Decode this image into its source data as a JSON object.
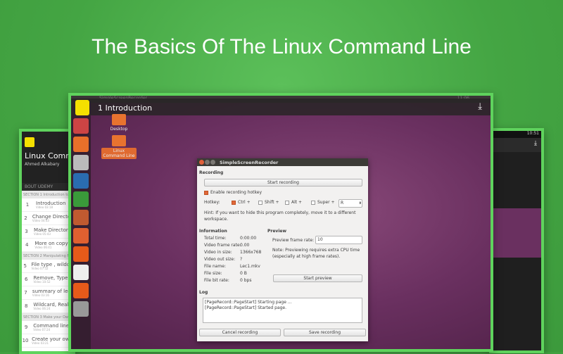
{
  "headline": "The Basics Of The Linux Command Line",
  "left_app": {
    "course_title": "Linux Comma",
    "author": "Ahmed Alkabary",
    "about": "BOUT UDEMY",
    "sections": [
      {
        "label": "SECTION 1  Introduction to th",
        "items": [
          {
            "n": "1",
            "t": "Introduction",
            "s": "Video 03:18"
          },
          {
            "n": "2",
            "t": "Change Director",
            "s": "Video 04:43"
          },
          {
            "n": "3",
            "t": "Make Directorie",
            "s": "Video 05:43"
          },
          {
            "n": "4",
            "t": "More on copyin",
            "s": "Video 06:41"
          }
        ]
      },
      {
        "label": "SECTION 2  Manipulating File",
        "items": [
          {
            "n": "5",
            "t": "File type , wildca",
            "s": "Video 07:52"
          },
          {
            "n": "6",
            "t": "Remove, Type o",
            "s": "Video 10:52"
          },
          {
            "n": "7",
            "t": "summary of lect",
            "s": "Video 03:16"
          },
          {
            "n": "8",
            "t": "Wildcard, Realiz",
            "s": "Video 06:24"
          }
        ]
      },
      {
        "label": "SECTION 3  Make your Own C",
        "items": [
          {
            "n": "9",
            "t": "Command line t",
            "s": "Video 07:24"
          },
          {
            "n": "10",
            "t": "Create your own",
            "s": "Video 03:21"
          }
        ]
      }
    ]
  },
  "right_app": {
    "clock": "10:51"
  },
  "main": {
    "lecture_title": "1  Introduction",
    "topbar_text": "SimpleScreenRecorder",
    "clock": "11:06",
    "desktop_icons": [
      "Desktop",
      "Linux Command Line"
    ],
    "launcher_icons": [
      "ubuntu-dash",
      "firefox",
      "files",
      "writer",
      "calc",
      "impress",
      "software-center",
      "udemy",
      "amazon",
      "udemy-alt",
      "stack"
    ],
    "dialog": {
      "title": "SimpleScreenRecorder",
      "recording_heading": "Recording",
      "start_recording": "Start recording",
      "enable_hotkey": "Enable recording hotkey",
      "hotkey_label": "Hotkey:",
      "ctrl": "Ctrl +",
      "shift": "Shift +",
      "alt": "Alt +",
      "super": "Super +",
      "key": "R",
      "hint": "Hint: If you want to hide this program completely, move it to a different workspace.",
      "information_heading": "Information",
      "info": [
        {
          "k": "Total time:",
          "v": "0:00:00"
        },
        {
          "k": "Video frame rate:",
          "v": "0.00"
        },
        {
          "k": "Video in size:",
          "v": "1366x768"
        },
        {
          "k": "Video out size:",
          "v": "?"
        },
        {
          "k": "File name:",
          "v": "Lec1.mkv"
        },
        {
          "k": "File size:",
          "v": "0 B"
        },
        {
          "k": "File bit rate:",
          "v": "0 bps"
        }
      ],
      "preview_heading": "Preview",
      "preview_rate_label": "Preview frame rate:",
      "preview_rate": "10",
      "preview_note": "Note: Previewing requires extra CPU time (especially at high frame rates).",
      "start_preview": "Start preview",
      "log_heading": "Log",
      "log": [
        "[PageRecord::PageStart] Starting page ...",
        "[PageRecord::PageStart] Started page."
      ],
      "cancel": "Cancel recording",
      "save": "Save recording"
    }
  }
}
